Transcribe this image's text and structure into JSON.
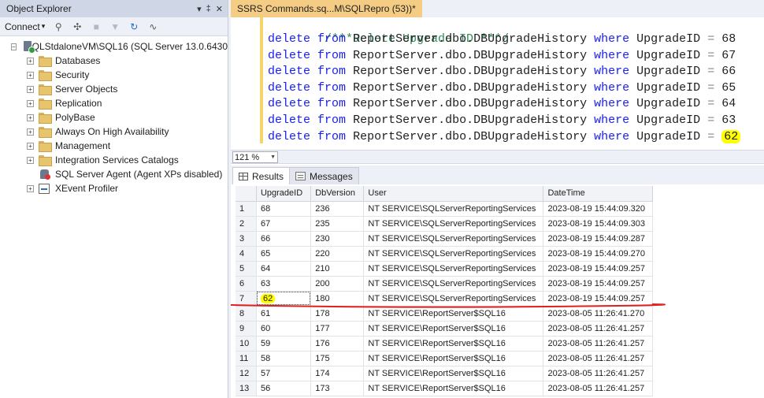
{
  "object_explorer": {
    "title": "Object Explorer",
    "title_buttons": [
      "▾",
      "‡",
      "✕"
    ],
    "toolbar": {
      "connect_label": "Connect",
      "connect_arrow": "▾"
    },
    "server_node": "SQLStdaloneVM\\SQL16 (SQL Server 13.0.6430",
    "nodes": [
      {
        "label": "Databases",
        "type": "folder"
      },
      {
        "label": "Security",
        "type": "folder"
      },
      {
        "label": "Server Objects",
        "type": "folder"
      },
      {
        "label": "Replication",
        "type": "folder"
      },
      {
        "label": "PolyBase",
        "type": "folder"
      },
      {
        "label": "Always On High Availability",
        "type": "folder"
      },
      {
        "label": "Management",
        "type": "folder"
      },
      {
        "label": "Integration Services Catalogs",
        "type": "folder"
      },
      {
        "label": "SQL Server Agent (Agent XPs disabled)",
        "type": "agent"
      },
      {
        "label": "XEvent Profiler",
        "type": "xevent"
      }
    ]
  },
  "editor": {
    "tab_title": "SSRS Commands.sq...M\\SQLRepro (53))*",
    "comment_line": "/***Delete Upgrade ID ***/",
    "statement": {
      "kw_delete": "delete",
      "kw_from": "from",
      "table": "ReportServer.dbo.DBUpgradeHistory",
      "kw_where": "where",
      "column": "UpgradeID",
      "op": "="
    },
    "ids": [
      "68",
      "67",
      "66",
      "65",
      "64",
      "63",
      "62"
    ],
    "highlight_color": "#ffff00",
    "zoom": "121 %"
  },
  "results": {
    "tabs": [
      "Results",
      "Messages"
    ],
    "columns": [
      "UpgradeID",
      "DbVersion",
      "User",
      "DateTime"
    ],
    "rows": [
      [
        "1",
        "68",
        "236",
        "NT SERVICE\\SQLServerReportingServices",
        "2023-08-19 15:44:09.320"
      ],
      [
        "2",
        "67",
        "235",
        "NT SERVICE\\SQLServerReportingServices",
        "2023-08-19 15:44:09.303"
      ],
      [
        "3",
        "66",
        "230",
        "NT SERVICE\\SQLServerReportingServices",
        "2023-08-19 15:44:09.287"
      ],
      [
        "4",
        "65",
        "220",
        "NT SERVICE\\SQLServerReportingServices",
        "2023-08-19 15:44:09.270"
      ],
      [
        "5",
        "64",
        "210",
        "NT SERVICE\\SQLServerReportingServices",
        "2023-08-19 15:44:09.257"
      ],
      [
        "6",
        "63",
        "200",
        "NT SERVICE\\SQLServerReportingServices",
        "2023-08-19 15:44:09.257"
      ],
      [
        "7",
        "62",
        "180",
        "NT SERVICE\\SQLServerReportingServices",
        "2023-08-19 15:44:09.257"
      ],
      [
        "8",
        "61",
        "178",
        "NT SERVICE\\ReportServer$SQL16",
        "2023-08-05 11:26:41.270"
      ],
      [
        "9",
        "60",
        "177",
        "NT SERVICE\\ReportServer$SQL16",
        "2023-08-05 11:26:41.257"
      ],
      [
        "10",
        "59",
        "176",
        "NT SERVICE\\ReportServer$SQL16",
        "2023-08-05 11:26:41.257"
      ],
      [
        "11",
        "58",
        "175",
        "NT SERVICE\\ReportServer$SQL16",
        "2023-08-05 11:26:41.257"
      ],
      [
        "12",
        "57",
        "174",
        "NT SERVICE\\ReportServer$SQL16",
        "2023-08-05 11:26:41.257"
      ],
      [
        "13",
        "56",
        "173",
        "NT SERVICE\\ReportServer$SQL16",
        "2023-08-05 11:26:41.257"
      ]
    ],
    "highlighted_row": 7,
    "annotation_color": "#e02020"
  }
}
